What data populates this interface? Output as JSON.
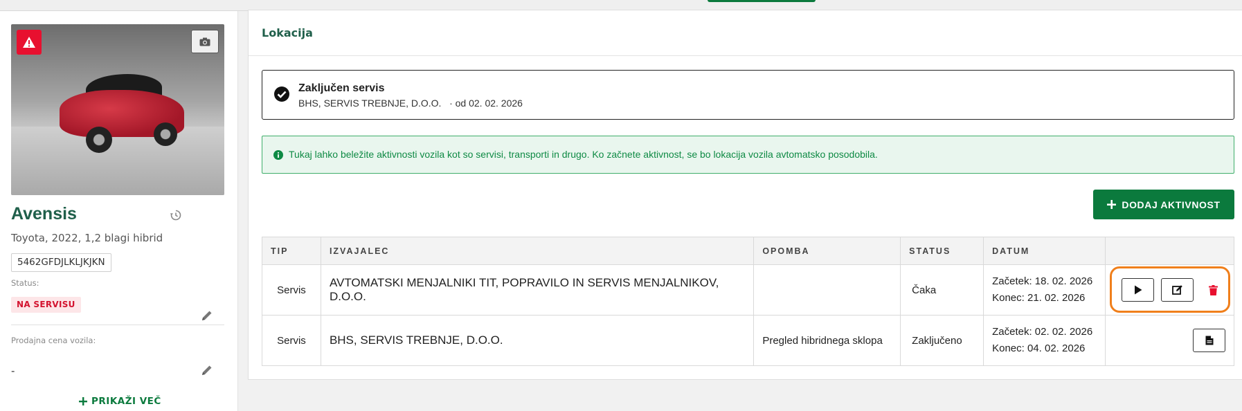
{
  "vehicle": {
    "name": "Avensis",
    "subtitle": "Toyota, 2022, 1,2 blagi hibrid",
    "vin": "5462GFDJLKLJKJKN",
    "status_label": "Status:",
    "status_value": "NA SERVISU",
    "price_label": "Prodajna cena vozila:",
    "price_value": "-",
    "show_more": "PRIKAŽI VEČ"
  },
  "main": {
    "title": "Lokacija",
    "location": {
      "title": "Zaključen servis",
      "subtitle": "BHS, SERVIS TREBNJE, D.O.O.   · od 02. 02. 2026"
    },
    "info": "Tukaj lahko beležite aktivnosti vozila kot so servisi, transporti in drugo. Ko začnete aktivnost, se bo lokacija vozila avtomatsko posodobila.",
    "add_button": "DODAJ AKTIVNOST",
    "table": {
      "headers": [
        "TIP",
        "IZVAJALEC",
        "OPOMBA",
        "STATUS",
        "DATUM",
        ""
      ],
      "rows": [
        {
          "tip": "Servis",
          "izvajalec": "AVTOMATSKI MENJALNIKI TIT, POPRAVILO IN SERVIS MENJALNIKOV, D.O.O.",
          "opomba": "",
          "status": "Čaka",
          "zacetek": "Začetek: 18. 02. 2026",
          "konec": "Konec: 21. 02. 2026"
        },
        {
          "tip": "Servis",
          "izvajalec": "BHS, SERVIS TREBNJE, D.O.O.",
          "opomba": "Pregled hibridnega sklopa",
          "status": "Zaključeno",
          "zacetek": "Začetek: 02. 02. 2026",
          "konec": "Konec: 04. 02. 2026"
        }
      ]
    }
  },
  "colors": {
    "brand_green": "#0b7a3d",
    "title_green": "#1f5f4a",
    "danger_red": "#e8102f",
    "highlight_orange": "#f07f1b"
  },
  "icons": [
    "warning-icon",
    "camera-icon",
    "history-icon",
    "pencil-icon",
    "plus-icon",
    "check-circle-icon",
    "info-icon",
    "play-icon",
    "edit-icon",
    "trash-icon",
    "document-icon"
  ]
}
